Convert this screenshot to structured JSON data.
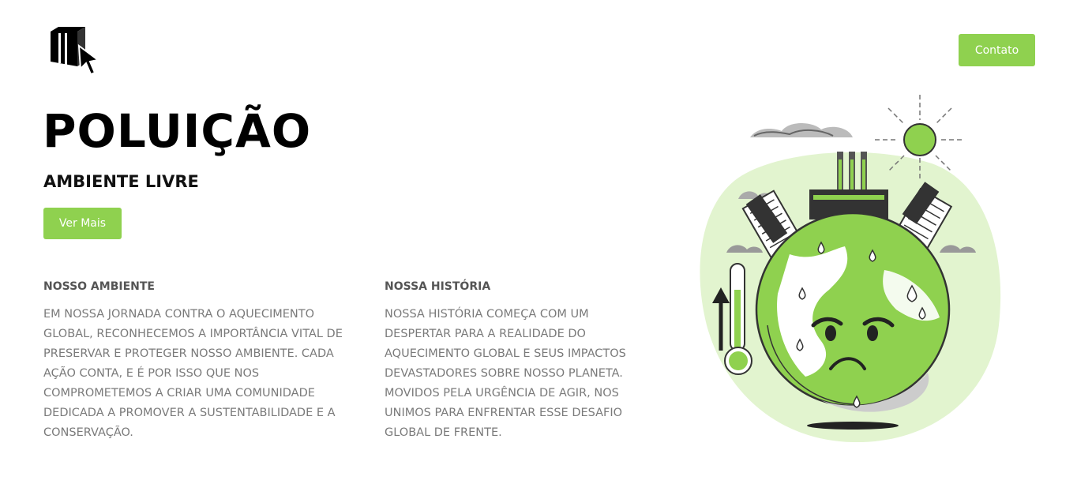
{
  "header": {
    "logo_icon": "box-cursor-icon",
    "contact_label": "Contato"
  },
  "hero": {
    "title": "POLUIÇÃO",
    "subtitle": "AMBIENTE LIVRE",
    "more_label": "Ver Mais"
  },
  "sections": [
    {
      "heading": "NOSSO AMBIENTE",
      "text": "EM NOSSA JORNADA CONTRA O AQUECIMENTO GLOBAL, RECONHECEMOS A IMPORTÂNCIA VITAL DE PRESERVAR E PROTEGER NOSSO AMBIENTE. CADA AÇÃO CONTA, E É POR ISSO QUE NOS COMPROMETEMOS A CRIAR UMA COMUNIDADE DEDICADA A PROMOVER A SUSTENTABILIDADE E A CONSERVAÇÃO."
    },
    {
      "heading": "NOSSA HISTÓRIA",
      "text": "NOSSA HISTÓRIA COMEÇA COM UM DESPERTAR PARA A REALIDADE DO AQUECIMENTO GLOBAL E SEUS IMPACTOS DEVASTADORES SOBRE NOSSO PLANETA. MOVIDOS PELA URGÊNCIA DE AGIR, NOS UNIMOS PARA ENFRENTAR ESSE DESAFIO GLOBAL DE FRENTE."
    }
  ],
  "illustration": {
    "icon": "sad-earth-global-warming-illustration",
    "colors": {
      "accent": "#8fd14f",
      "light_green": "#e2f4cf",
      "dark": "#222222"
    }
  }
}
